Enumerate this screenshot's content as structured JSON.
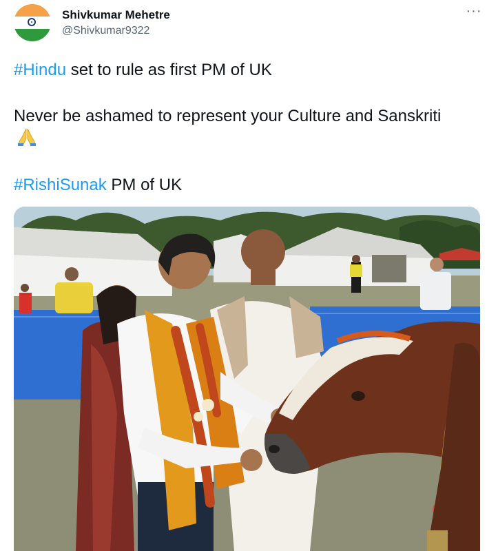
{
  "user": {
    "display_name": "Shivkumar Mehetre",
    "handle": "@Shivkumar9322",
    "avatar_icon": "india-flag-icon"
  },
  "tweet": {
    "line1_hashtag": "#Hindu",
    "line1_text": " set to rule as first PM of UK",
    "line2_text": "Never be ashamed to represent your Culture and Sanskriti",
    "line2_emoji": "folded-hands-icon",
    "line3_hashtag": "#RishiSunak",
    "line3_text": " PM of UK"
  },
  "more_icon": "more-options-icon",
  "colors": {
    "hashtag": "#1d9bf0",
    "text": "#0f1419",
    "secondary": "#536471"
  }
}
